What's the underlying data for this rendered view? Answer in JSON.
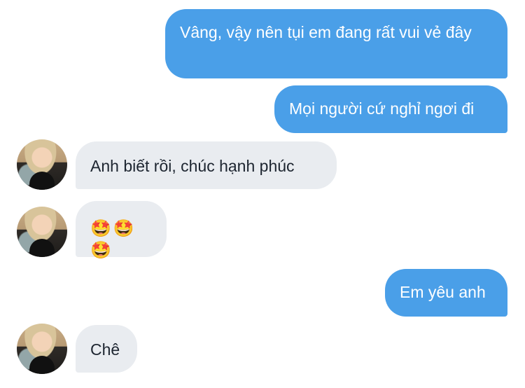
{
  "messages": [
    {
      "side": "out",
      "text": "Vâng, vậy nên tụi em đang rất vui vẻ đây"
    },
    {
      "side": "out",
      "text": "Mọi người cứ nghỉ ngơi đi"
    },
    {
      "side": "in",
      "text": "Anh biết rồi, chúc hạnh phúc"
    },
    {
      "side": "in",
      "text": "🤩🤩🤩"
    },
    {
      "side": "out",
      "text": "Em yêu anh"
    },
    {
      "side": "in",
      "text": "Chê"
    }
  ],
  "colors": {
    "outgoing_bubble": "#4a9fe8",
    "incoming_bubble": "#e9ecf0",
    "incoming_text": "#1d2530"
  },
  "icons": {
    "avatar": "contact-avatar-photo"
  }
}
